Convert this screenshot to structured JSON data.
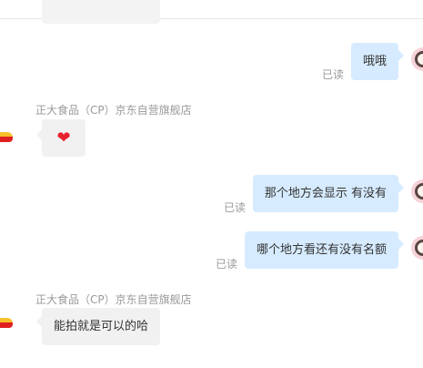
{
  "shop_name": "正大食品（CP）京东自营旗舰店",
  "read_label": "已读",
  "messages": [
    {
      "text": "哦哦"
    },
    {
      "emoji": "heart-emoji"
    },
    {
      "text": "那个地方会显示 有没有"
    },
    {
      "text": "哪个地方看还有没有名额"
    },
    {
      "text": "能拍就是可以的哈"
    }
  ],
  "colors": {
    "outgoing_bubble": "#d6ebff",
    "incoming_bubble": "#f1f1f1",
    "meta_text": "#9a9a9a",
    "heart": "#e8212e"
  }
}
